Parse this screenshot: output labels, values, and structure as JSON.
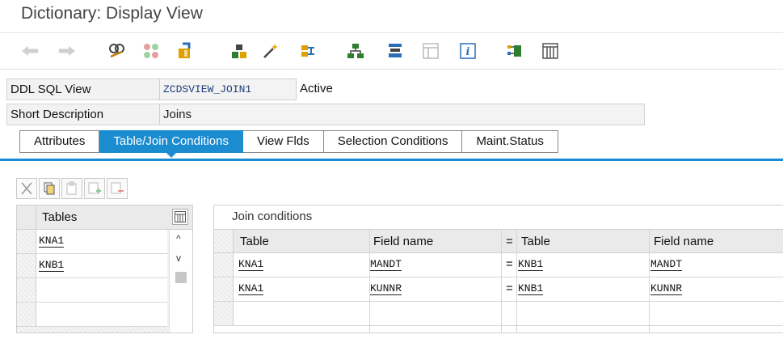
{
  "window": {
    "title": "Dictionary: Display View"
  },
  "toolbar": {
    "icons": [
      "back-arrow-icon",
      "forward-arrow-icon",
      "display-change-icon",
      "other-object-icon",
      "activate-icon",
      "where-used-icon",
      "magic-wand-icon",
      "navigation-tree-icon",
      "hierarchy-icon",
      "stack-icon",
      "layout-icon",
      "info-icon",
      "relationships-icon",
      "columns-icon"
    ]
  },
  "header": {
    "ddl_label": "DDL SQL View",
    "ddl_value": "ZCDSVIEW_JOIN1",
    "status": "Active",
    "desc_label": "Short Description",
    "desc_value": "Joins"
  },
  "tabs": [
    {
      "label": "Attributes",
      "active": false
    },
    {
      "label": "Table/Join Conditions",
      "active": true
    },
    {
      "label": "View Flds",
      "active": false
    },
    {
      "label": "Selection Conditions",
      "active": false
    },
    {
      "label": "Maint.Status",
      "active": false
    }
  ],
  "colors": {
    "accent": "#1b8cd0"
  },
  "tables_grid": {
    "header": "Tables",
    "rows": [
      "KNA1",
      "KNB1"
    ],
    "scroll_up": "^",
    "scroll_down": "v"
  },
  "join_conditions": {
    "title": "Join conditions",
    "headers": {
      "table1": "Table",
      "field1": "Field name",
      "eq": "=",
      "table2": "Table",
      "field2": "Field name"
    },
    "rows": [
      {
        "table1": "KNA1",
        "field1": "MANDT",
        "eq": "=",
        "table2": "KNB1",
        "field2": "MANDT"
      },
      {
        "table1": "KNA1",
        "field1": "KUNNR",
        "eq": "=",
        "table2": "KNB1",
        "field2": "KUNNR"
      }
    ]
  }
}
